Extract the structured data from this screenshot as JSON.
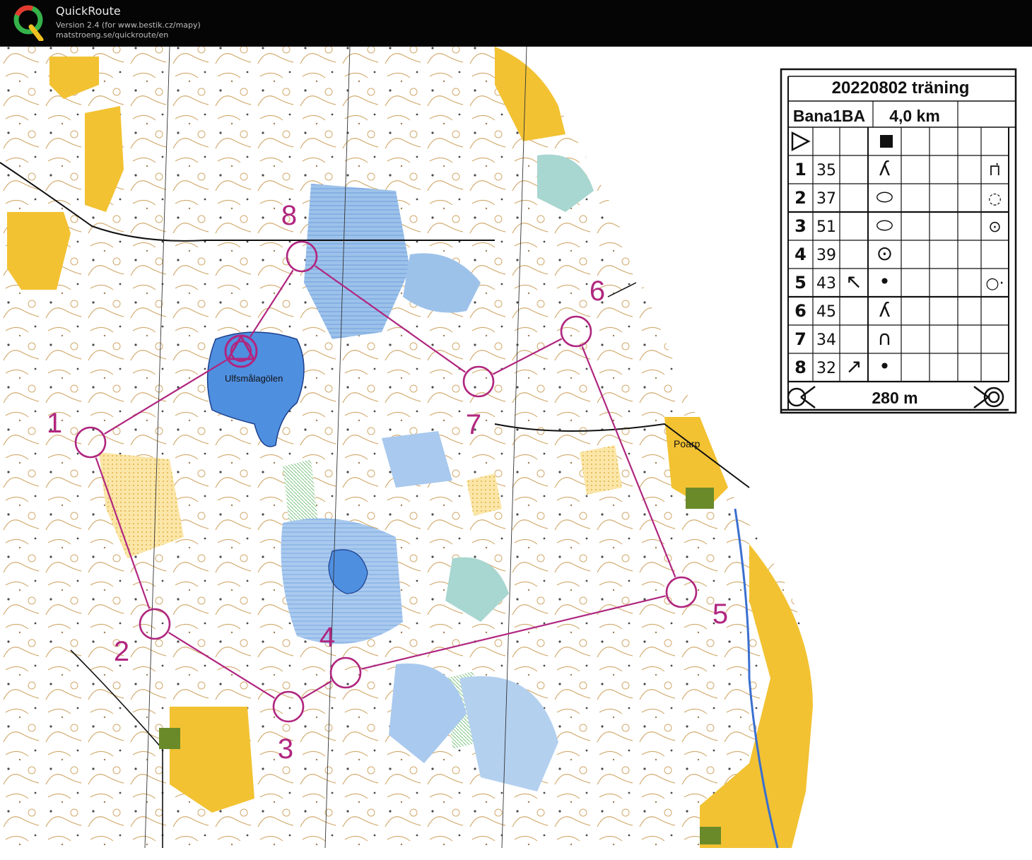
{
  "app": {
    "title": "QuickRoute",
    "version_line": "Version 2.4  (for www.bestik.cz/mapy)",
    "url_line": "matstroeng.se/quickroute/en"
  },
  "map": {
    "lake_label": "Ulfsmålagölen",
    "place_label": "Poarp",
    "colors": {
      "course": "#b0267f",
      "water": "#6fa0dc",
      "open_land": "#f2c232",
      "paper": "#ffffff"
    },
    "controls": [
      {
        "number": "1"
      },
      {
        "number": "2"
      },
      {
        "number": "3"
      },
      {
        "number": "4"
      },
      {
        "number": "5"
      },
      {
        "number": "6"
      },
      {
        "number": "7"
      },
      {
        "number": "8"
      }
    ]
  },
  "description_sheet": {
    "event": "20220802 träning",
    "course": "Bana1BA",
    "length": "4,0 km",
    "rows": [
      {
        "num": "1",
        "code": "35",
        "dir": "",
        "feature": "ʎ",
        "appearance": "",
        "detail": "⊓̇"
      },
      {
        "num": "2",
        "code": "37",
        "dir": "",
        "feature": "⬭",
        "appearance": "",
        "detail": "◌"
      },
      {
        "num": "3",
        "code": "51",
        "dir": "",
        "feature": "⬭",
        "appearance": "",
        "detail": "⊙"
      },
      {
        "num": "4",
        "code": "39",
        "dir": "",
        "feature": "⊙",
        "appearance": "",
        "detail": ""
      },
      {
        "num": "5",
        "code": "43",
        "dir": "↖",
        "feature": "•",
        "appearance": "",
        "detail": "○·"
      },
      {
        "num": "6",
        "code": "45",
        "dir": "",
        "feature": "ʎ",
        "appearance": "",
        "detail": ""
      },
      {
        "num": "7",
        "code": "34",
        "dir": "",
        "feature": "∩",
        "appearance": "",
        "detail": ""
      },
      {
        "num": "8",
        "code": "32",
        "dir": "↗",
        "feature": "•",
        "appearance": "",
        "detail": ""
      }
    ],
    "finish_distance": "280 m"
  }
}
